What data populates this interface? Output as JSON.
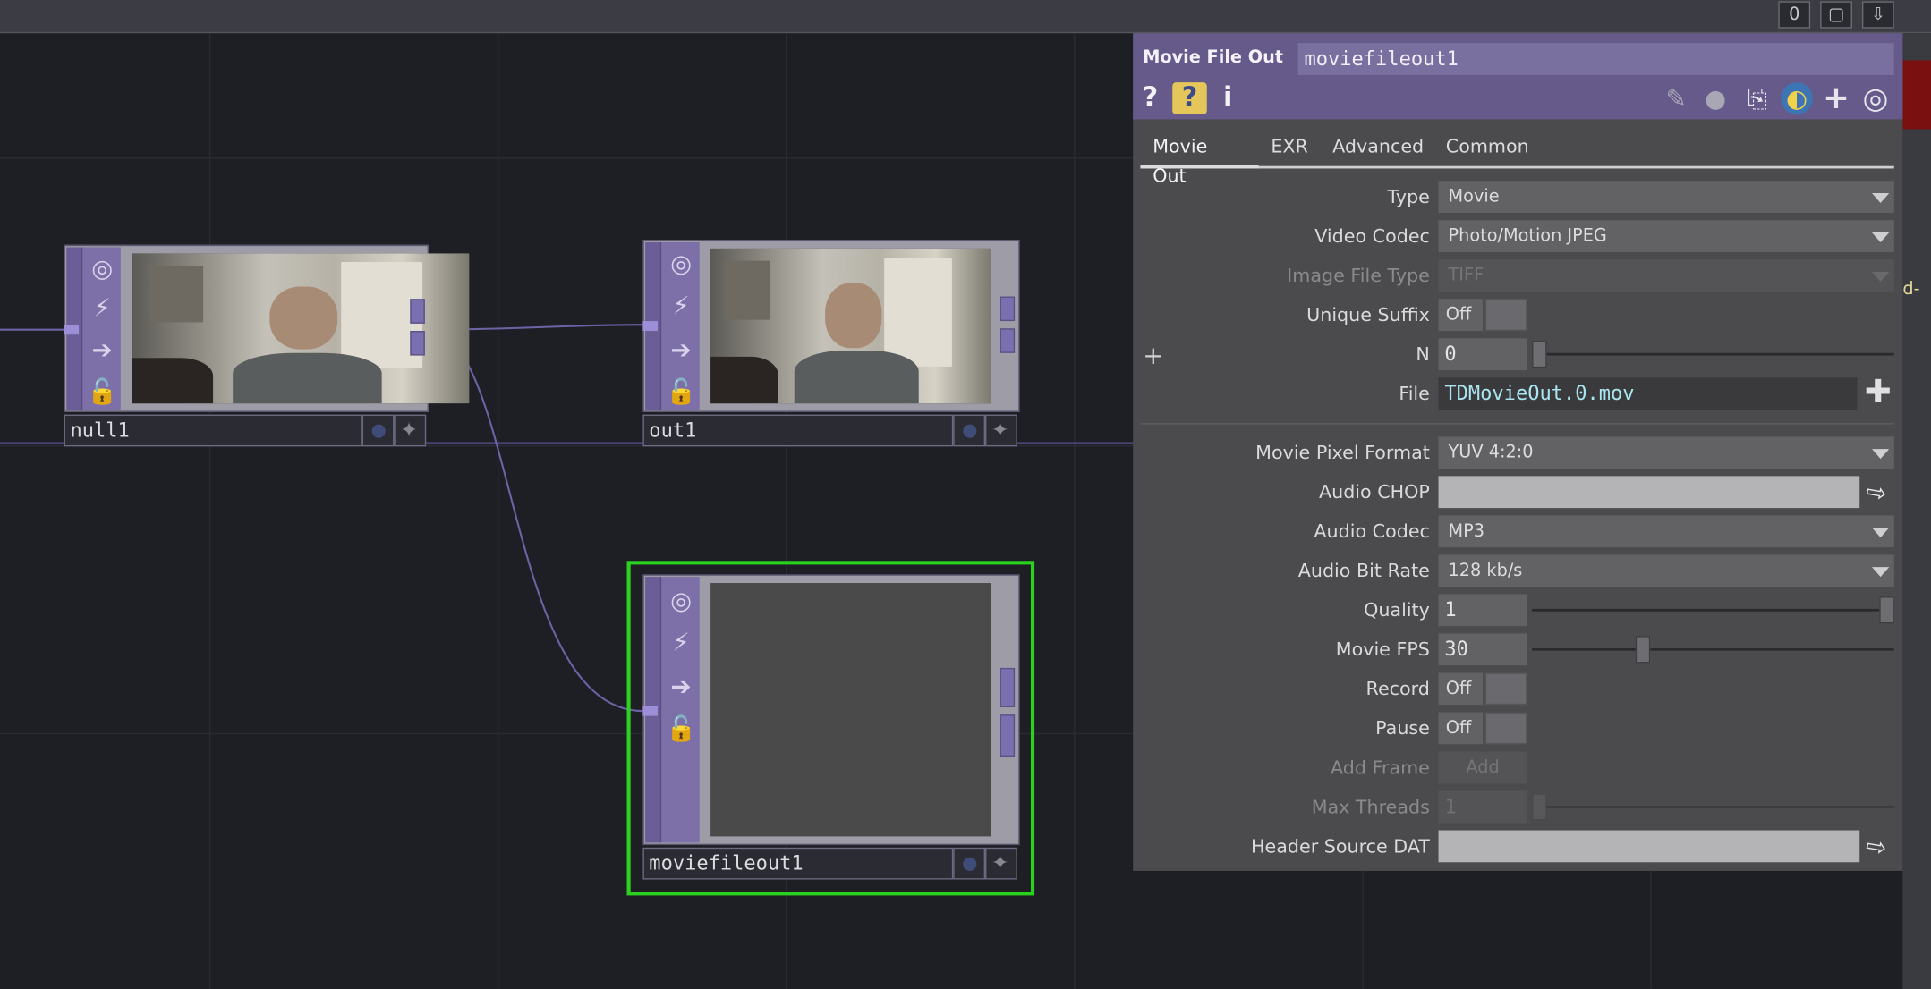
{
  "window": {
    "top_buttons": [
      "0",
      "▢",
      "⇩"
    ],
    "edge_text": "d-"
  },
  "nodes": {
    "null1": {
      "label": "null1"
    },
    "out1": {
      "label": "out1"
    },
    "moviefileout1": {
      "label": "moviefileout1"
    }
  },
  "panel": {
    "op_type": "Movie File Out",
    "op_name": "moviefileout1",
    "header_icons": [
      "help-icon",
      "python-help-icon",
      "info-icon",
      "pencil-icon",
      "comment-icon",
      "clipboard-icon",
      "python-icon",
      "add-icon",
      "target-icon"
    ],
    "tabs": [
      "Movie Out",
      "EXR",
      "Advanced",
      "Common"
    ],
    "active_tab": "Movie Out",
    "params": {
      "type": {
        "label": "Type",
        "value": "Movie"
      },
      "video_codec": {
        "label": "Video Codec",
        "value": "Photo/Motion JPEG"
      },
      "image_file_type": {
        "label": "Image File Type",
        "value": "TIFF"
      },
      "unique_suffix": {
        "label": "Unique Suffix",
        "value": "Off"
      },
      "n": {
        "label": "N",
        "value": "0"
      },
      "file": {
        "label": "File",
        "value": "TDMovieOut.0.mov"
      },
      "movie_pixel_format": {
        "label": "Movie Pixel Format",
        "value": "YUV 4:2:0"
      },
      "audio_chop": {
        "label": "Audio CHOP",
        "value": ""
      },
      "audio_codec": {
        "label": "Audio Codec",
        "value": "MP3"
      },
      "audio_bit_rate": {
        "label": "Audio Bit Rate",
        "value": "128 kb/s"
      },
      "quality": {
        "label": "Quality",
        "value": "1"
      },
      "movie_fps": {
        "label": "Movie FPS",
        "value": "30"
      },
      "record": {
        "label": "Record",
        "value": "Off"
      },
      "pause": {
        "label": "Pause",
        "value": "Off"
      },
      "add_frame": {
        "label": "Add Frame",
        "value": "Add"
      },
      "max_threads": {
        "label": "Max Threads",
        "value": "1"
      },
      "header_source_dat": {
        "label": "Header Source DAT",
        "value": ""
      }
    }
  },
  "colors": {
    "panel_header": "#655a8a",
    "node_purple": "#7d6fa8",
    "selected_outline": "#2ad21f",
    "file_text": "#a9e6f0"
  }
}
